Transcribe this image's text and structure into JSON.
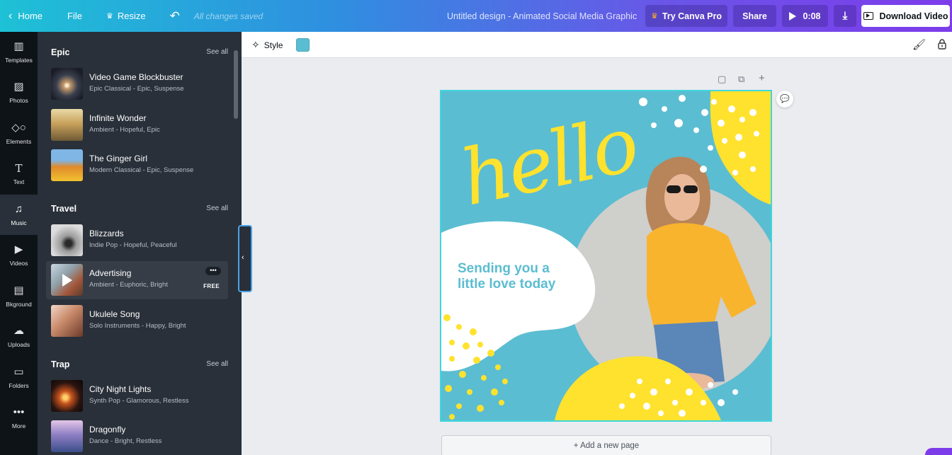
{
  "topbar": {
    "home": "Home",
    "file": "File",
    "resize": "Resize",
    "saved": "All changes saved",
    "title": "Untitled design - Animated Social Media Graphic",
    "try_pro": "Try Canva Pro",
    "share": "Share",
    "duration": "0:08",
    "download_video": "Download Video"
  },
  "rail": [
    {
      "label": "Templates",
      "icon": "templates-icon"
    },
    {
      "label": "Photos",
      "icon": "photos-icon"
    },
    {
      "label": "Elements",
      "icon": "elements-icon"
    },
    {
      "label": "Text",
      "icon": "text-icon"
    },
    {
      "label": "Music",
      "icon": "music-icon",
      "active": true
    },
    {
      "label": "Videos",
      "icon": "videos-icon"
    },
    {
      "label": "Bkground",
      "icon": "background-icon"
    },
    {
      "label": "Uploads",
      "icon": "uploads-icon"
    },
    {
      "label": "Folders",
      "icon": "folders-icon"
    },
    {
      "label": "More",
      "icon": "more-icon"
    }
  ],
  "panel": {
    "see_all": "See all",
    "sections": [
      {
        "title": "Epic",
        "tracks": [
          {
            "name": "Video Game Blockbuster",
            "meta": "Epic Classical - Epic, Suspense"
          },
          {
            "name": "Infinite Wonder",
            "meta": "Ambient - Hopeful, Epic"
          },
          {
            "name": "The Ginger Girl",
            "meta": "Modern Classical - Epic, Suspense"
          }
        ]
      },
      {
        "title": "Travel",
        "tracks": [
          {
            "name": "Blizzards",
            "meta": "Indie Pop - Hopeful, Peaceful"
          },
          {
            "name": "Advertising",
            "meta": "Ambient - Euphoric, Bright",
            "badge": "FREE"
          },
          {
            "name": "Ukulele Song",
            "meta": "Solo Instruments - Happy, Bright"
          }
        ]
      },
      {
        "title": "Trap",
        "tracks": [
          {
            "name": "City Night Lights",
            "meta": "Synth Pop - Glamorous, Restless"
          },
          {
            "name": "Dragonfly",
            "meta": "Dance - Bright, Restless"
          }
        ]
      }
    ]
  },
  "toolbar": {
    "style": "Style",
    "swatch_color": "#5bbdd1"
  },
  "design": {
    "script_text": "hello",
    "message_line1": "Sending you a",
    "message_line2": "little love today"
  },
  "canvas": {
    "add_page": "+ Add a new page"
  }
}
